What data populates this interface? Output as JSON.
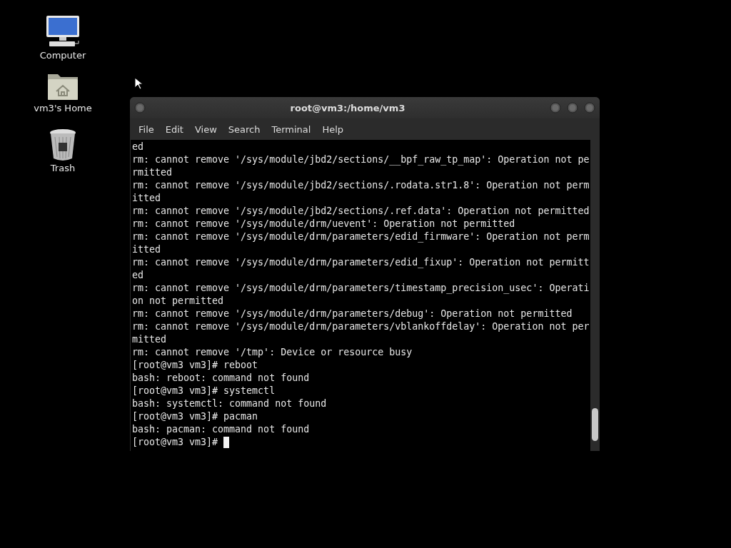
{
  "desktop_icons": [
    {
      "kind": "computer",
      "label": "Computer"
    },
    {
      "kind": "home",
      "label": "vm3's Home"
    },
    {
      "kind": "trash",
      "label": "Trash"
    }
  ],
  "window": {
    "title": "root@vm3:/home/vm3",
    "menu": [
      "File",
      "Edit",
      "View",
      "Search",
      "Terminal",
      "Help"
    ],
    "lines": [
      "ed",
      "rm: cannot remove '/sys/module/jbd2/sections/__bpf_raw_tp_map': Operation not pe",
      "rmitted",
      "rm: cannot remove '/sys/module/jbd2/sections/.rodata.str1.8': Operation not perm",
      "itted",
      "rm: cannot remove '/sys/module/jbd2/sections/.ref.data': Operation not permitted",
      "rm: cannot remove '/sys/module/drm/uevent': Operation not permitted",
      "rm: cannot remove '/sys/module/drm/parameters/edid_firmware': Operation not perm",
      "itted",
      "rm: cannot remove '/sys/module/drm/parameters/edid_fixup': Operation not permitt",
      "ed",
      "rm: cannot remove '/sys/module/drm/parameters/timestamp_precision_usec': Operati",
      "on not permitted",
      "rm: cannot remove '/sys/module/drm/parameters/debug': Operation not permitted",
      "rm: cannot remove '/sys/module/drm/parameters/vblankoffdelay': Operation not per",
      "mitted",
      "rm: cannot remove '/tmp': Device or resource busy",
      "[root@vm3 vm3]# reboot",
      "bash: reboot: command not found",
      "[root@vm3 vm3]# systemctl",
      "bash: systemctl: command not found",
      "[root@vm3 vm3]# pacman",
      "bash: pacman: command not found"
    ],
    "prompt": "[root@vm3 vm3]#"
  }
}
